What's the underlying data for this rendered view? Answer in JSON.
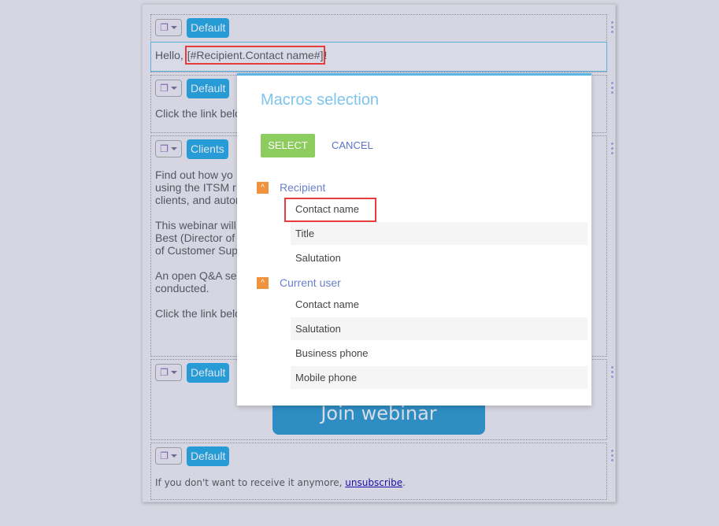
{
  "blocks": [
    {
      "tag": "Default",
      "text": "Hello, ",
      "macro": "[#Recipient.Contact name#]",
      "after": "!"
    },
    {
      "tag": "Default",
      "text": "Click the link belo"
    },
    {
      "tag": "Clients",
      "lines": [
        "Find out how yo",
        "using the ITSM r",
        "clients, and autor",
        "",
        "This webinar will",
        "Best (Director of",
        "of Customer Sup",
        "",
        "An open Q&A se",
        "conducted.",
        "",
        "Click the link belo"
      ]
    },
    {
      "tag": "Default",
      "button": "Join webinar"
    },
    {
      "tag": "Default",
      "text": "If you don't want to receive it anymore, ",
      "link": "unsubscribe",
      "after": "."
    }
  ],
  "dialog": {
    "title": "Macros selection",
    "select": "SELECT",
    "cancel": "CANCEL",
    "groups": [
      {
        "label": "Recipient",
        "items": [
          "Contact name",
          "Title",
          "Salutation"
        ]
      },
      {
        "label": "Current user",
        "items": [
          "Contact name",
          "Salutation",
          "Business phone",
          "Mobile phone"
        ]
      }
    ]
  }
}
